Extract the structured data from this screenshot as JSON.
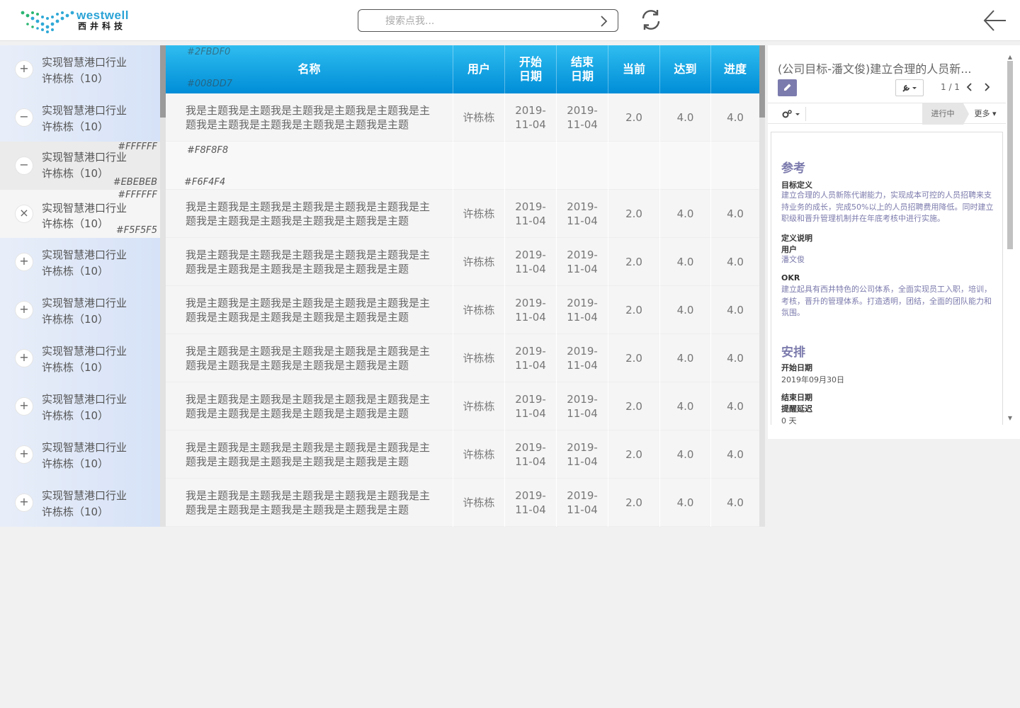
{
  "app": {
    "logo_en": "westwell",
    "logo_cn": "西井科技",
    "search_placeholder": "搜索点我..."
  },
  "icons": {
    "search_go": "chevron-right-icon",
    "refresh": "refresh-icon",
    "back": "arrow-left-icon",
    "edit": "pencil-icon",
    "wrench": "wrench-icon",
    "gears": "gears-icon"
  },
  "colors": {
    "header_gradient_top": "#2FBDF0",
    "header_gradient_bottom": "#008DD7",
    "accent": "#7C7BAD"
  },
  "sidebar": {
    "items": [
      {
        "button": "+",
        "title": "实现智慧港口行业",
        "sub": "许栋栋（10）",
        "style": "blue"
      },
      {
        "button": "−",
        "title": "实现智慧港口行业",
        "sub": "许栋栋（10）",
        "style": "blue"
      },
      {
        "button": "−",
        "title": "实现智慧港口行业",
        "sub": "许栋栋（10）",
        "style": "grey",
        "note_top": "#FFFFFF",
        "note_bottom": "#EBEBEB"
      },
      {
        "button": "×",
        "title": "实现智慧港口行业",
        "sub": "许栋栋（10）",
        "style": "light",
        "note_top": "#FFFFFF",
        "note_bottom": "#F5F5F5"
      },
      {
        "button": "+",
        "title": "实现智慧港口行业",
        "sub": "许栋栋（10）",
        "style": "blue"
      },
      {
        "button": "+",
        "title": "实现智慧港口行业",
        "sub": "许栋栋（10）",
        "style": "blue"
      },
      {
        "button": "+",
        "title": "实现智慧港口行业",
        "sub": "许栋栋（10）",
        "style": "blue"
      },
      {
        "button": "+",
        "title": "实现智慧港口行业",
        "sub": "许栋栋（10）",
        "style": "blue"
      },
      {
        "button": "+",
        "title": "实现智慧港口行业",
        "sub": "许栋栋（10）",
        "style": "blue"
      },
      {
        "button": "+",
        "title": "实现智慧港口行业",
        "sub": "许栋栋（10）",
        "style": "blue"
      }
    ]
  },
  "table": {
    "header_note_top": "#2FBDF0",
    "header_note_bottom": "#008DD7",
    "columns": {
      "name": "名称",
      "user": "用户",
      "start_1": "开始",
      "start_2": "日期",
      "end_1": "结束",
      "end_2": "日期",
      "current": "当前",
      "reach": "达到",
      "progress": "进度"
    },
    "spacer_note_top": "#F8F8F8",
    "spacer_note_bottom": "#F6F4F4",
    "rows": [
      {
        "name": "我是主题我是主题我是主题我是主题我是主题我是主题我是主题我是主题我是主题我是主题我是主题",
        "user": "许栋栋",
        "start": "2019-11-04",
        "end": "2019-11-04",
        "current": "2.0",
        "reach": "4.0",
        "progress": "4.0"
      },
      {
        "name": "",
        "user": "",
        "start": "",
        "end": "",
        "current": "",
        "reach": "",
        "progress": ""
      },
      {
        "name": "我是主题我是主题我是主题我是主题我是主题我是主题我是主题我是主题我是主题我是主题我是主题",
        "user": "许栋栋",
        "start": "2019-11-04",
        "end": "2019-11-04",
        "current": "2.0",
        "reach": "4.0",
        "progress": "4.0"
      },
      {
        "name": "我是主题我是主题我是主题我是主题我是主题我是主题我是主题我是主题我是主题我是主题我是主题",
        "user": "许栋栋",
        "start": "2019-11-04",
        "end": "2019-11-04",
        "current": "2.0",
        "reach": "4.0",
        "progress": "4.0"
      },
      {
        "name": "我是主题我是主题我是主题我是主题我是主题我是主题我是主题我是主题我是主题我是主题我是主题",
        "user": "许栋栋",
        "start": "2019-11-04",
        "end": "2019-11-04",
        "current": "2.0",
        "reach": "4.0",
        "progress": "4.0"
      },
      {
        "name": "我是主题我是主题我是主题我是主题我是主题我是主题我是主题我是主题我是主题我是主题我是主题",
        "user": "许栋栋",
        "start": "2019-11-04",
        "end": "2019-11-04",
        "current": "2.0",
        "reach": "4.0",
        "progress": "4.0"
      },
      {
        "name": "我是主题我是主题我是主题我是主题我是主题我是主题我是主题我是主题我是主题我是主题我是主题",
        "user": "许栋栋",
        "start": "2019-11-04",
        "end": "2019-11-04",
        "current": "2.0",
        "reach": "4.0",
        "progress": "4.0"
      },
      {
        "name": "我是主题我是主题我是主题我是主题我是主题我是主题我是主题我是主题我是主题我是主题我是主题",
        "user": "许栋栋",
        "start": "2019-11-04",
        "end": "2019-11-04",
        "current": "2.0",
        "reach": "4.0",
        "progress": "4.0"
      },
      {
        "name": "我是主题我是主题我是主题我是主题我是主题我是主题我是主题我是主题我是主题我是主题我是主题",
        "user": "许栋栋",
        "start": "2019-11-04",
        "end": "2019-11-04",
        "current": "2.0",
        "reach": "4.0",
        "progress": "4.0"
      }
    ]
  },
  "panel": {
    "title": "(公司目标-潘文俊)建立合理的人员新...",
    "pager": "1 / 1",
    "stage_active": "进行中",
    "stage_more": "更多",
    "section_ref": "参考",
    "label_goal": "目标定义",
    "value_goal": "建立合理的人员新陈代谢能力，实现成本可控的人员招聘来支持业务的成长，完成50%以上的人员招聘费用降低。同时建立职级和晋升管理机制并在年底考核中进行实施。",
    "label_def": "定义说明",
    "label_user": "用户",
    "value_user": "潘文俊",
    "label_okr": "OKR",
    "value_okr": "建立起具有西井特色的公司体系，全面实现员工入职，培训，考核，晋升的管理体系。打造透明，团结，全面的团队能力和氛围。",
    "section_plan": "安排",
    "label_start": "开始日期",
    "value_start": "2019年09月30日",
    "label_end": "结束日期",
    "label_remind": "提醒延迟",
    "value_remind": "0 天"
  }
}
